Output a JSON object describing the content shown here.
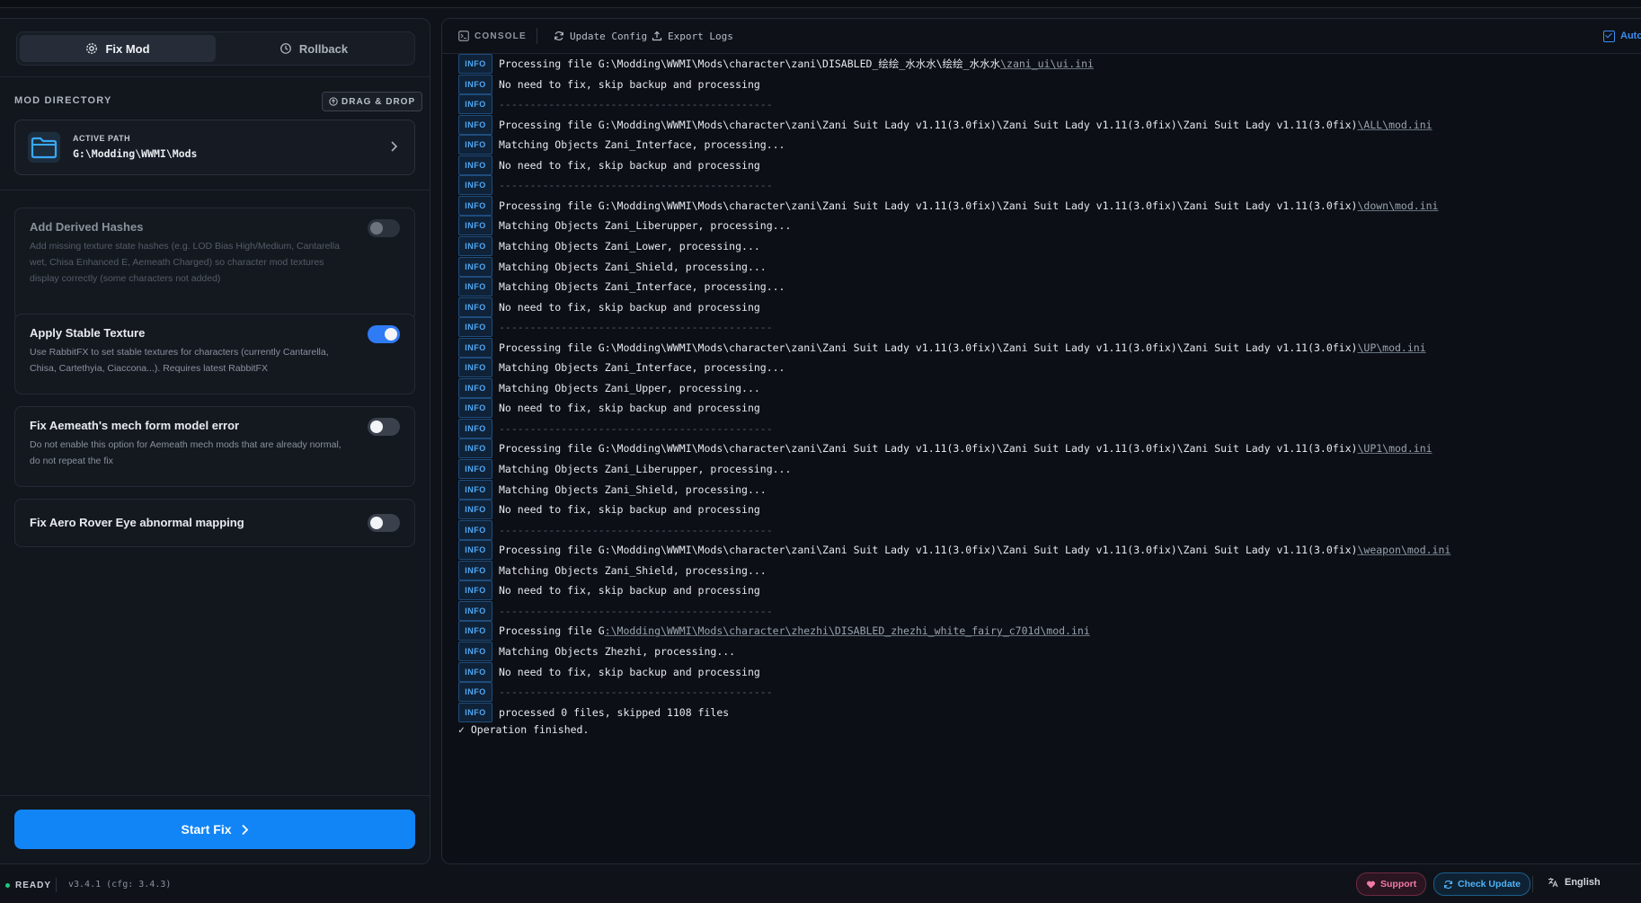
{
  "tabs": {
    "fix": "Fix Mod",
    "rollback": "Rollback"
  },
  "mod_directory": {
    "title": "MOD DIRECTORY",
    "drag_drop": "DRAG & DROP",
    "active_path_label": "ACTIVE PATH",
    "active_path_value": "G:\\Modding\\WWMI\\Mods"
  },
  "options": [
    {
      "title": "Add Derived Hashes",
      "desc": "Add missing texture state hashes (e.g. LOD Bias High/Medium, Cantarella wet, Chisa Enhanced E, Aemeath Charged) so character mod textures display correctly (some characters not added)",
      "state": "disabled"
    },
    {
      "title": "Apply Stable Texture",
      "desc": "Use RabbitFX to set stable textures for characters (currently Cantarella, Chisa, Cartethyia, Ciaccona...). Requires latest RabbitFX",
      "state": "on"
    },
    {
      "title": "Fix Aemeath's mech form model error",
      "desc": "Do not enable this option for Aemeath mech mods that are already normal, do not repeat the fix",
      "state": "off"
    },
    {
      "title": "Fix Aero Rover Eye abnormal mapping",
      "desc": "",
      "state": "off"
    }
  ],
  "start_button": "Start Fix",
  "console": {
    "label": "CONSOLE",
    "update_config": "Update Config",
    "export_logs": "Export Logs",
    "auto_label": "Auto",
    "tag": "INFO",
    "lines": [
      {
        "text": "Processing file G:\\Modding\\WWMI\\Mods\\character\\zani\\DISABLED_绘绘_水水水\\绘绘_水水水",
        "link": "\\zani_ui\\ui.ini"
      },
      {
        "text": "No need to fix, skip backup and processing"
      },
      {
        "text": "--------------------------------------------",
        "dash": true
      },
      {
        "text": "Processing file G:\\Modding\\WWMI\\Mods\\character\\zani\\Zani Suit Lady v1.11(3.0fix)\\Zani Suit Lady v1.11(3.0fix)\\Zani Suit Lady v1.11(3.0fix)",
        "link": "\\ALL\\mod.ini"
      },
      {
        "text": "Matching Objects Zani_Interface, processing..."
      },
      {
        "text": "No need to fix, skip backup and processing"
      },
      {
        "text": "--------------------------------------------",
        "dash": true
      },
      {
        "text": "Processing file G:\\Modding\\WWMI\\Mods\\character\\zani\\Zani Suit Lady v1.11(3.0fix)\\Zani Suit Lady v1.11(3.0fix)\\Zani Suit Lady v1.11(3.0fix)",
        "link": "\\down\\mod.ini"
      },
      {
        "text": "Matching Objects Zani_Liberupper, processing..."
      },
      {
        "text": "Matching Objects Zani_Lower, processing..."
      },
      {
        "text": "Matching Objects Zani_Shield, processing..."
      },
      {
        "text": "Matching Objects Zani_Interface, processing..."
      },
      {
        "text": "No need to fix, skip backup and processing"
      },
      {
        "text": "--------------------------------------------",
        "dash": true
      },
      {
        "text": "Processing file G:\\Modding\\WWMI\\Mods\\character\\zani\\Zani Suit Lady v1.11(3.0fix)\\Zani Suit Lady v1.11(3.0fix)\\Zani Suit Lady v1.11(3.0fix)",
        "link": "\\UP\\mod.ini"
      },
      {
        "text": "Matching Objects Zani_Interface, processing..."
      },
      {
        "text": "Matching Objects Zani_Upper, processing..."
      },
      {
        "text": "No need to fix, skip backup and processing"
      },
      {
        "text": "--------------------------------------------",
        "dash": true
      },
      {
        "text": "Processing file G:\\Modding\\WWMI\\Mods\\character\\zani\\Zani Suit Lady v1.11(3.0fix)\\Zani Suit Lady v1.11(3.0fix)\\Zani Suit Lady v1.11(3.0fix)",
        "link": "\\UP1\\mod.ini"
      },
      {
        "text": "Matching Objects Zani_Liberupper, processing..."
      },
      {
        "text": "Matching Objects Zani_Shield, processing..."
      },
      {
        "text": "No need to fix, skip backup and processing"
      },
      {
        "text": "--------------------------------------------",
        "dash": true
      },
      {
        "text": "Processing file G:\\Modding\\WWMI\\Mods\\character\\zani\\Zani Suit Lady v1.11(3.0fix)\\Zani Suit Lady v1.11(3.0fix)\\Zani Suit Lady v1.11(3.0fix)",
        "link": "\\weapon\\mod.ini"
      },
      {
        "text": "Matching Objects Zani_Shield, processing..."
      },
      {
        "text": "No need to fix, skip backup and processing"
      },
      {
        "text": "--------------------------------------------",
        "dash": true
      },
      {
        "text": "Processing file G",
        "link": ":\\Modding\\WWMI\\Mods\\character\\zhezhi\\DISABLED_zhezhi_white_fairy_c701d\\mod.ini"
      },
      {
        "text": "Matching Objects Zhezhi, processing..."
      },
      {
        "text": "No need to fix, skip backup and processing"
      },
      {
        "text": "--------------------------------------------",
        "dash": true
      },
      {
        "text": "processed 0 files, skipped 1108 files"
      }
    ],
    "finished": "✓ Operation finished."
  },
  "status": {
    "ready": "READY",
    "version": "v3.4.1 (cfg: 3.4.3)",
    "support": "Support",
    "check_update": "Check Update",
    "language": "English"
  },
  "colors": {
    "accent": "#1185f5",
    "toggle_on": "#2f7bf5",
    "info_tag": "#4fa8f4",
    "ready_dot": "#1ec780",
    "support": "#f27aa6"
  }
}
